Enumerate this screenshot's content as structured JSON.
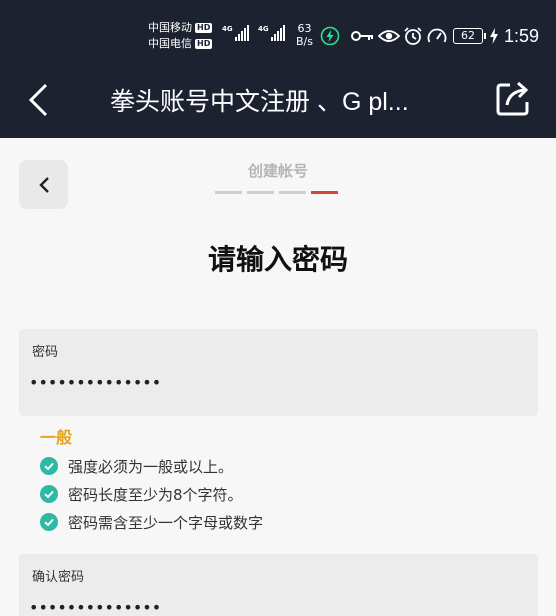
{
  "status_bar": {
    "carriers": [
      {
        "name": "中国移动",
        "badge": "HD"
      },
      {
        "name": "中国电信",
        "badge": "HD"
      }
    ],
    "signal_labels": [
      "4G",
      "4G"
    ],
    "net_speed_value": "63",
    "net_speed_unit": "B/s",
    "battery": "62",
    "time": "1:59",
    "icons": [
      "charging-icon",
      "key-icon",
      "eye-icon",
      "alarm-icon",
      "speedometer-icon",
      "battery-icon"
    ]
  },
  "title_bar": {
    "title": "拳头账号中文注册 、G pl...",
    "icons": [
      "back-arrow-icon",
      "share-icon"
    ]
  },
  "form": {
    "step_label": "创建帐号",
    "steps_total": 4,
    "current_step": 4,
    "heading": "请输入密码",
    "password": {
      "label": "密码",
      "value": "••••••••••••••"
    },
    "strength": "一般",
    "rules": [
      {
        "text": "强度必须为一般或以上。",
        "met": true
      },
      {
        "text": "密码长度至少为8个字符。",
        "met": true
      },
      {
        "text": "密码需含至少一个字母或数字",
        "met": true
      }
    ],
    "confirm": {
      "label": "确认密码",
      "value": "••••••••••••••"
    }
  },
  "colors": {
    "header_bg": "#1d2230",
    "active_step": "#d2463c",
    "strength_text": "#e2a41c",
    "check_green": "#2fb9a5"
  }
}
